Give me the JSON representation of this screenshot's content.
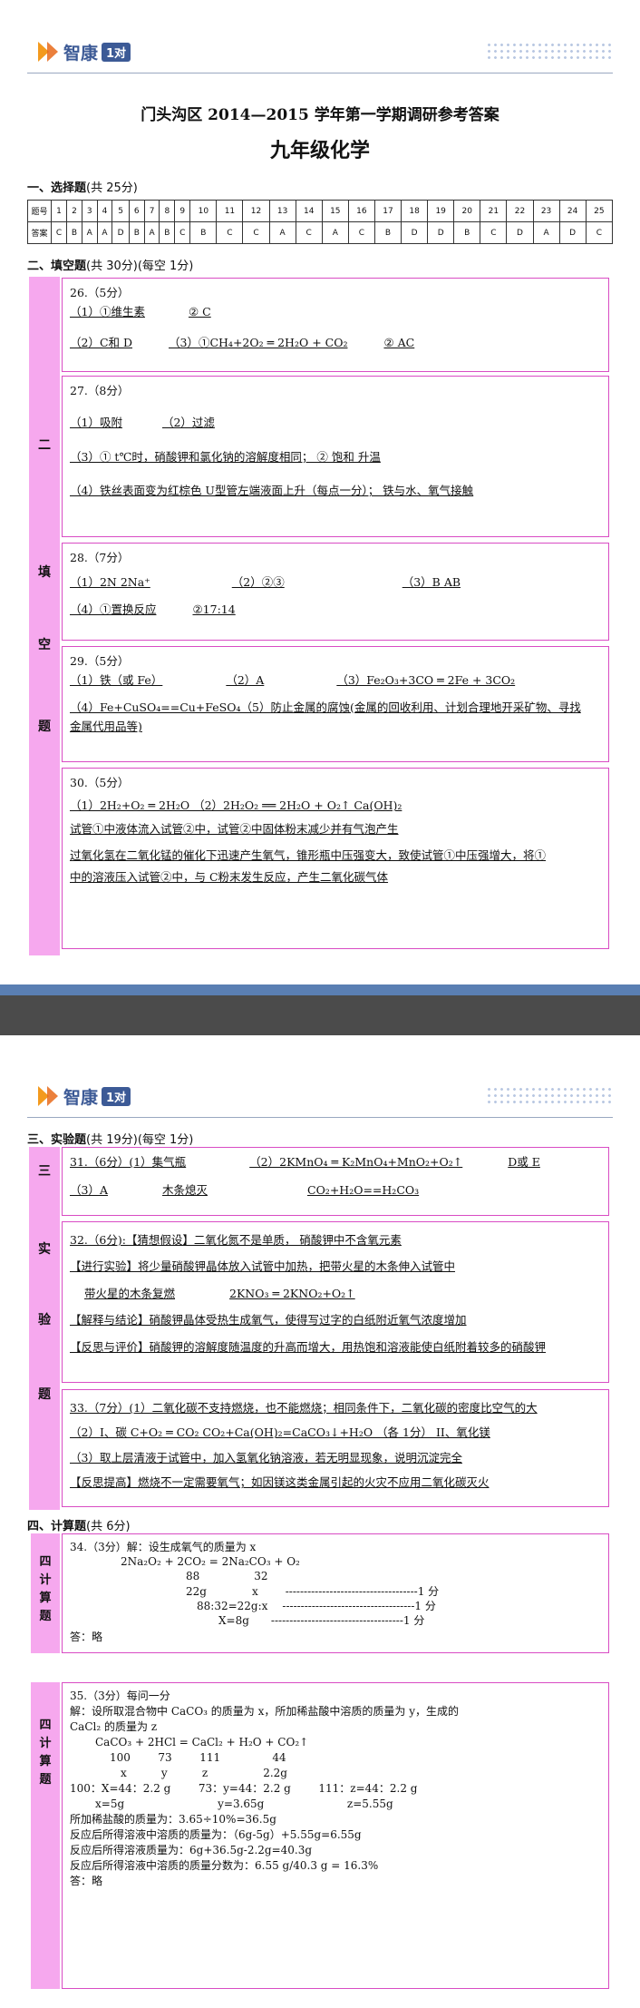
{
  "brand": {
    "name": "智康",
    "badge": "1对"
  },
  "header": {
    "title": "门头沟区 2014—2015 学年第一学期调研参考答案",
    "subject": "九年级化学"
  },
  "sections": {
    "s1": {
      "label": "一、选择题",
      "note": "(共 25分)"
    },
    "s2": {
      "label": "二、填空题",
      "note": "(共 30分)(每空 1分)"
    },
    "s3": {
      "label": "三、实验题",
      "note": "(共 19分)(每空 1分)"
    },
    "s4": {
      "label": "四、计算题",
      "note": "(共 6分)"
    }
  },
  "mc_table": {
    "row1_label": "题号",
    "row2_label": "答案",
    "numbers": [
      "1",
      "2",
      "3",
      "4",
      "5",
      "6",
      "7",
      "8",
      "9",
      "10",
      "11",
      "12",
      "13",
      "14",
      "15",
      "16",
      "17",
      "18",
      "19",
      "20",
      "21",
      "22",
      "23",
      "24",
      "25"
    ],
    "answers": [
      "C",
      "B",
      "A",
      "A",
      "D",
      "B",
      "A",
      "B",
      "C",
      "B",
      "C",
      "C",
      "A",
      "C",
      "A",
      "C",
      "B",
      "D",
      "D",
      "B",
      "C",
      "D",
      "A",
      "D",
      "C"
    ]
  },
  "side_labels": {
    "fill": [
      "二",
      "填",
      "空",
      "题"
    ],
    "exp": [
      "三",
      "实",
      "验",
      "题"
    ],
    "calc1": [
      "四",
      "计",
      "算",
      "题"
    ],
    "calc2": [
      "四",
      "计",
      "算",
      "题"
    ]
  },
  "q26": {
    "head": "26.（5分）",
    "l1a": "（1）①维生素",
    "l1b": "②  C",
    "l2a": "（2）C和 D",
    "l2b": "（3）①CH₄+2O₂ ═ 2H₂O + CO₂",
    "l2c": "②  AC"
  },
  "q27": {
    "head": "27.（8分）",
    "l1a": "（1）吸附",
    "l1b": "（2）过滤",
    "l2": "（3）① t℃时，硝酸钾和氯化钠的溶解度相同；  ②   饱和           升温",
    "l3": "（4）铁丝表面变为红棕色    U型管左端液面上升（每点一分）；   铁与水、氧气接触"
  },
  "q28": {
    "head": "28.（7分）",
    "l1a": "（1）2N       2Na⁺",
    "l1b": "（2）②③",
    "l1c": "（3）B         AB",
    "l2a": "（4）①置换反应",
    "l2b": "②17:14"
  },
  "q29": {
    "head": "29.（5分）",
    "l1a": "（1）铁（或 Fe）",
    "l1b": "（2）A",
    "l1c": "（3）Fe₂O₃+3CO ═ 2Fe + 3CO₂",
    "l2": "（4）Fe+CuSO₄==Cu+FeSO₄（5）防止金属的腐蚀(金属的回收利用、计划合理地开采矿物、寻找",
    "l3": "金属代用品等)"
  },
  "q30": {
    "head": "30.（5分）",
    "l1": "（1）2H₂+O₂ ═ 2H₂O      （2）2H₂O₂ ══ 2H₂O + O₂↑        Ca(OH)₂",
    "l2": "试管①中液体流入试管②中，试管②中固体粉末减少并有气泡产生",
    "l3": "过氧化氢在二氧化锰的催化下迅速产生氧气，锥形瓶中压强变大，致使试管①中压强增大，将①",
    "l4": "中的溶液压入试管②中，与 C粉末发生反应，产生二氧化碳气体"
  },
  "q31": {
    "l1a": "31.（6分）(1）集气瓶",
    "l1b": "（2）2KMnO₄ ═ K₂MnO₄+MnO₂+O₂↑",
    "l1c": "D或 E",
    "l2a": "（3）A",
    "l2b": "木条熄灭",
    "l2c": "CO₂+H₂O==H₂CO₃"
  },
  "q32": {
    "l1": "32.（6分):【猜想假设】二氧化氮不是单质，   硝酸钾中不含氧元素",
    "l2": "【进行实验】将少量硝酸钾晶体放入试管中加热，把带火星的木条伸入试管中",
    "l3a": "带火星的木条复燃",
    "l3b": "2KNO₃ ═ 2KNO₂+O₂↑",
    "l4": "【解释与结论】硝酸钾晶体受热生成氧气，使得写过字的白纸附近氧气浓度增加",
    "l5": "【反思与评价】硝酸钾的溶解度随温度的升高而增大，用热饱和溶液能使白纸附着较多的硝酸钾"
  },
  "q33": {
    "l1": "33.（7分）(1）二氧化碳不支持燃烧，也不能燃烧；相同条件下，二氧化碳的密度比空气的大",
    "l2": "（2）I、碳       C+O₂ ═ CO₂        CO₂+Ca(OH)₂=CaCO₃↓+H₂O （各 1分）    II、氧化镁",
    "l3": "（3）取上层清液于试管中，加入氢氧化钠溶液，若无明显现象，说明沉淀完全",
    "l4": "【反思提高】燃烧不一定需要氧气；如因镁这类金属引起的火灾不应用二氧化碳灭火"
  },
  "q34": {
    "l1": "34.（3分）解：设生成氧气的质量为 x",
    "l2": "2Na₂O₂ + 2CO₂ = 2Na₂CO₃ + O₂",
    "l3a": "88",
    "l3b": "32",
    "l4a": "22g",
    "l4b": "x",
    "l4c": "------------------------------------1 分",
    "l5a": "88:32=22g:x",
    "l5c": "------------------------------------1 分",
    "l6a": "X=8g",
    "l6c": "------------------------------------1 分",
    "l7": "答：略"
  },
  "q35": {
    "l1": "35.（3分）每问一分",
    "l2": "解：设所取混合物中 CaCO₃ 的质量为 x，所加稀盐酸中溶质的质量为 y，生成的",
    "l3": "CaCl₂ 的质量为 z",
    "l4": "CaCO₃ + 2HCl = CaCl₂ + H₂O + CO₂↑",
    "l5": "100        73        111               44",
    "l6": "x          y          z                2.2g",
    "l7": "100：X=44：2.2 g        73：y=44：2.2 g        111：z=44：2.2 g",
    "l8": "x=5g                           y=3.65g                        z=5.55g",
    "l9": "所加稀盐酸的质量为：3.65÷10%=36.5g",
    "l10": "反应后所得溶液中溶质的质量为：（6g-5g）+5.55g=6.55g",
    "l11": "反应后所得溶液质量为：6g+36.5g-2.2g=40.3g",
    "l12": "反应后所得溶液中溶质的质量分数为：6.55 g/40.3 g = 16.3%",
    "l13": "答：略"
  }
}
